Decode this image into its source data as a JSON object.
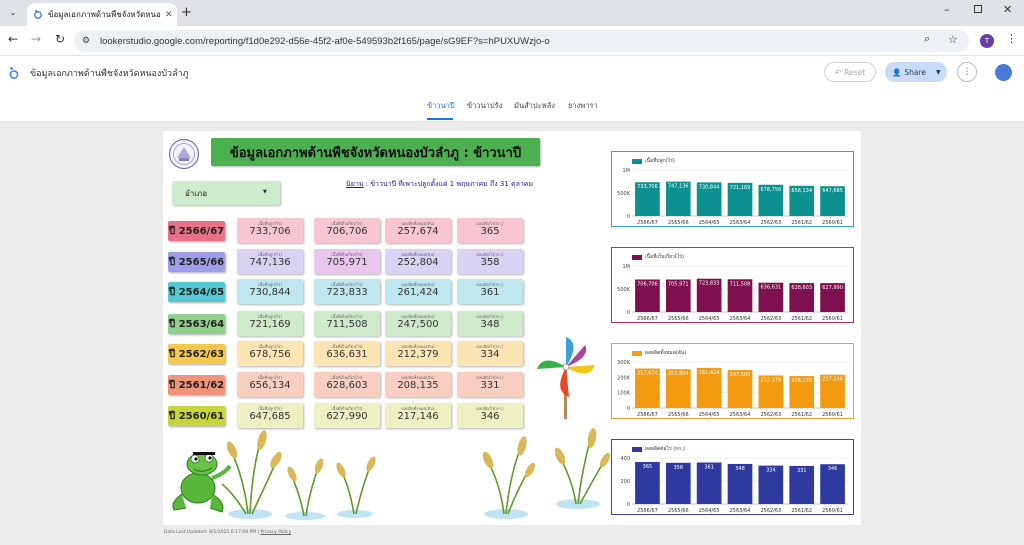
{
  "browser": {
    "tab_title": "ข้อมูลเอกภาพด้านพืชจังหวัดหนองบัวลำ...",
    "url": "lookerstudio.google.com/reporting/f1d0e292-d56e-45f2-af0e-549593b2f165/page/sG9EF?s=hPUXUWzjo-o",
    "profile_initial": "T"
  },
  "header": {
    "title": "ข้อมูลเอกภาพด้านพืชจังหวัดหนองบัวลำภู",
    "reset_label": "Reset",
    "share_label": "Share"
  },
  "page_tabs": [
    "ข้าวนาปี",
    "ข้าวนาปรัง",
    "มันสำปะหลัง",
    "ยางพารา"
  ],
  "report": {
    "banner": "ข้อมูลเอกภาพด้านพืชจังหวัดหนองบัวลำภู : ข้าวนาปี",
    "filter_label": "อำเภอ",
    "definition_term": "นิยาม",
    "definition_text": " : ข้าวนาปี ที่เพาะปลูกตั้งแต่ 1 พฤษภาคม ถึง 31 ตุลาคม",
    "card_labels": [
      "เนื้อที่ปลูก(ไร่)",
      "เนื้อที่เก็บเกี่ยว(ไร่)",
      "ผลผลิตทั้งหมด(ตัน)",
      "ผลผลิต/ไร่(กก.)"
    ],
    "rows": [
      {
        "year": "ปี 2566/67",
        "color": "#e87088",
        "cells": [
          "733,706",
          "706,706",
          "257,674",
          "365"
        ]
      },
      {
        "year": "ปี 2565/66",
        "color": "#9d9ee8",
        "cells": [
          "747,136",
          "705,971",
          "252,804",
          "358"
        ]
      },
      {
        "year": "ปี 2564/65",
        "color": "#55c8d6",
        "cells": [
          "730,844",
          "723,833",
          "261,424",
          "361"
        ]
      },
      {
        "year": "ปี 2563/64",
        "color": "#8fd08c",
        "cells": [
          "721,169",
          "711,508",
          "247,500",
          "348"
        ]
      },
      {
        "year": "ปี 2562/63",
        "color": "#f4c84a",
        "cells": [
          "678,756",
          "636,631",
          "212,379",
          "334"
        ]
      },
      {
        "year": "ปี 2561/62",
        "color": "#f0957a",
        "cells": [
          "656,134",
          "628,603",
          "208,135",
          "331"
        ]
      },
      {
        "year": "ปี 2560/61",
        "color": "#c8d63c",
        "cells": [
          "647,685",
          "627,990",
          "217,146",
          "346"
        ]
      }
    ],
    "card_colors": [
      [
        "#f7c6d1",
        "#f7c6d1",
        "#f7c6d1",
        "#f7c6d1"
      ],
      [
        "#d9d2f3",
        "#e8c6ee",
        "#d9d2f3",
        "#d9d2f3"
      ],
      [
        "#bfe7ef",
        "#bfe7ef",
        "#bfe7ef",
        "#bfe7ef"
      ],
      [
        "#cfeacb",
        "#cfeacb",
        "#cfeacb",
        "#cfeacb"
      ],
      [
        "#fbe6b3",
        "#fbe6b3",
        "#fbe6b3",
        "#fbe6b3"
      ],
      [
        "#f9cfc1",
        "#f9cfc1",
        "#f9cfc1",
        "#f9cfc1"
      ],
      [
        "#eef0c2",
        "#eef0c2",
        "#eef0c2",
        "#eef0c2"
      ]
    ],
    "footer_updated": "Data Last Updated: 8/1/2025 6:17:09 PM",
    "footer_privacy": "Privacy Policy"
  },
  "chart_data": [
    {
      "type": "bar",
      "series": [
        {
          "name": "เนื้อที่ปลูก(ไร่)",
          "values": [
            733706,
            747136,
            730844,
            721169,
            678756,
            656134,
            647685
          ]
        }
      ],
      "categories": [
        "2566/67",
        "2565/66",
        "2564/65",
        "2563/64",
        "2562/63",
        "2561/62",
        "2560/61"
      ],
      "data_labels": [
        "733,706",
        "747,136",
        "730,844",
        "721,169",
        "678,756",
        "656,134",
        "647,685"
      ],
      "yticks": [
        "0",
        "500K",
        "1M"
      ],
      "ylim": [
        0,
        1000000
      ],
      "color": "#0c9090",
      "border": "#3aa0c8"
    },
    {
      "type": "bar",
      "series": [
        {
          "name": "เนื้อที่เก็บเกี่ยว(ไร่)",
          "values": [
            706706,
            705971,
            723833,
            711508,
            636631,
            628603,
            627990
          ]
        }
      ],
      "categories": [
        "2566/67",
        "2565/66",
        "2564/65",
        "2563/64",
        "2562/63",
        "2561/62",
        "2560/61"
      ],
      "data_labels": [
        "706,706",
        "705,971",
        "723,833",
        "711,508",
        "636,631",
        "628,603",
        "627,990"
      ],
      "yticks": [
        "0",
        "500K",
        "1M"
      ],
      "ylim": [
        0,
        1000000
      ],
      "color": "#7e1050",
      "border": "#b0306e"
    },
    {
      "type": "bar",
      "series": [
        {
          "name": "ผลผลิตทั้งหมด(ตัน)",
          "values": [
            257674,
            252804,
            261424,
            247500,
            212379,
            208135,
            217146
          ]
        }
      ],
      "categories": [
        "2566/67",
        "2565/66",
        "2564/65",
        "2563/64",
        "2562/63",
        "2561/62",
        "2560/61"
      ],
      "data_labels": [
        "257,674",
        "252,804",
        "261,424",
        "247,500",
        "212,379",
        "208,135",
        "217,146"
      ],
      "yticks": [
        "0",
        "100K",
        "200K",
        "300K"
      ],
      "ylim": [
        0,
        300000
      ],
      "color": "#f29a10",
      "border": "#e8a030"
    },
    {
      "type": "bar",
      "series": [
        {
          "name": "ผลผลิตต่อไร่ (กก.)",
          "values": [
            365,
            358,
            361,
            348,
            334,
            331,
            346
          ]
        }
      ],
      "categories": [
        "2566/67",
        "2565/66",
        "2564/65",
        "2563/64",
        "2562/63",
        "2561/62",
        "2560/61"
      ],
      "data_labels": [
        "365",
        "358",
        "361",
        "348",
        "334",
        "331",
        "346"
      ],
      "yticks": [
        "0",
        "200",
        "400"
      ],
      "ylim": [
        0,
        400
      ],
      "color": "#2e3aa0",
      "border": "#3a4a9a"
    }
  ]
}
